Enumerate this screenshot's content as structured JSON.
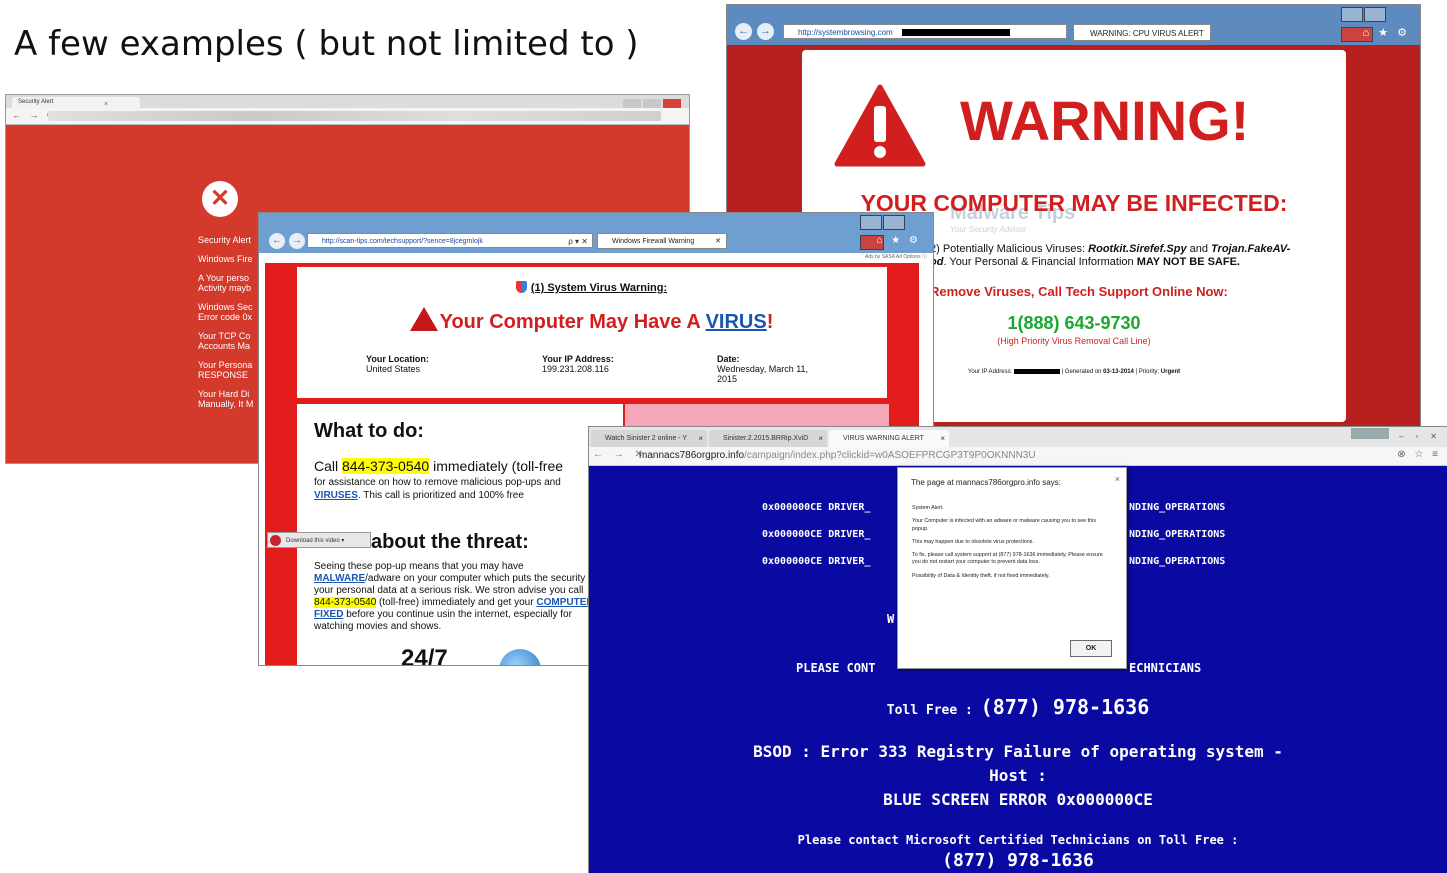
{
  "heading": "A few examples ( but not limited to )",
  "shot1": {
    "tab_title": "Security Alert",
    "tab_close": "×",
    "nav_icons": "← → C",
    "lines": [
      "Security Alert",
      "Windows Fire",
      "A Your perso\nActivity mayb",
      "Windows Sec\nError code 0x",
      "Your TCP Co\nAccounts Ma",
      "Your Persona\nRESPONSE",
      "Your Hard Di\nManually, It M"
    ]
  },
  "shot2": {
    "url": "http://systembrowsing.com",
    "tab_title": "WARNING: CPU VIRUS ALERT",
    "nav_back": "←",
    "nav_fwd": "→",
    "tools": "⌂ ★ ⚙",
    "warning": "WARNING!",
    "infected": "YOUR COMPUTER MAY BE INFECTED:",
    "watermark": "Malware Tips",
    "watermark_sub": "Your Security Advisor",
    "body_1": "2) Potentially Malicious Viruses: ",
    "body_virus": "Rootkit.Sirefef.Spy",
    "body_and": " and ",
    "body_virus2": "Trojan.FakeAV-",
    "body_virus2b": "od",
    "body_2": ". Your Personal & Financial Information ",
    "body_strong": "MAY NOT BE SAFE.",
    "remove": "Remove Viruses, Call Tech Support Online Now:",
    "phone": "1(888) 643-9730",
    "phone_sub": "(High Priority Virus Removal Call Line)",
    "ip_label": "Your IP Address: ",
    "ip_generated": " | Generated on ",
    "ip_date": "03-13-2014",
    "ip_priority": " | Priority: ",
    "ip_priority_val": "Urgent"
  },
  "shot3": {
    "url": "http://scan-tips.com/techsupport/?sence=8jcegmlojk",
    "url_buttons": "ρ ▾ ✕",
    "tab_title": "Windows Firewall Warning",
    "tab_close": "✕",
    "nav_back": "←",
    "nav_fwd": "→",
    "tools": "⌂ ★ ⚙",
    "ads": "Ads by SASA       Ad Options ⓘ",
    "system_warning": "(1) System Virus Warning:",
    "headline_pre": "Your Computer May Have A ",
    "headline_link": "VIRUS",
    "headline_post": "!",
    "location_label": "Your Location:",
    "location_value": "United States",
    "ip_label": "Your IP Address:",
    "ip_value": "199.231.208.116",
    "date_label": "Date:",
    "date_value": "Wednesday, March 11,\n2015",
    "what_to_do": "What to do:",
    "call_pre": "Call ",
    "call_number": "844-373-0540",
    "call_post": " immediately (toll-free",
    "assist_1": "for assistance on how to remove malicious pop-ups and",
    "assist_link": "VIRUSES",
    "assist_2": ". This call is prioritized and 100% free",
    "download_label": "Download this video ▾",
    "about": "about the threat:",
    "seeing_1": "Seeing these pop-up means that you may have",
    "seeing_link1": "MALWARE",
    "seeing_2": "/adware on your computer which puts the security of your personal data at a serious risk. We stron advise you call ",
    "seeing_number": "844-373-0540",
    "seeing_3": " (toll-free) immediately and get your ",
    "seeing_link2": "COMPUTER FIXED",
    "seeing_4": " before you continue usin the internet, especially for watching movies and shows.",
    "twentyfour": "24/7"
  },
  "shot4": {
    "tabs": [
      {
        "label": "Watch Sinister 2 online - Y",
        "close": "×"
      },
      {
        "label": "Sinister.2.2015.BRRip.XviD",
        "close": "×"
      },
      {
        "label": "VIRUS WARNING ALERT",
        "close": "×"
      }
    ],
    "win_buttons": [
      "–",
      "▫",
      "✕"
    ],
    "url_host": "mannacs786orgpro.info",
    "url_path": "/campaign/index.php?clickid=w0ASOEFPRCGP3T9P0OKNNN3U",
    "nav_icons": "← → ✕",
    "right_icons": "⊗ ☆ ≡",
    "driver_left": "0x000000CE DRIVER_",
    "driver_right": "NDING_OPERATIONS",
    "w_fragment": "W",
    "please_left": "PLEASE CONT",
    "please_right": "ECHNICIANS",
    "tollfree_label": "Toll Free : ",
    "tollfree_number": "(877) 978-1636",
    "bsod_1": "BSOD : Error 333 Registry Failure of operating system -",
    "bsod_2": "Host :",
    "bsod_3": "BLUE SCREEN ERROR 0x000000CE",
    "contact": "Please contact Microsoft Certified Technicians on Toll Free :",
    "contact_number": "(877) 978-1636",
    "dialog": {
      "title": "The page at mannacs786orgpro.info says:",
      "close": "×",
      "messages": [
        "System Alert.",
        "Your Computer is infected with an adware or malware causing you to see this popup.",
        "This may happen due to obsolete virus protections.",
        "To fix, please call system support at (877) 978-1636 immediately. Please ensure you do not restart your computer to prevent data loss.",
        "Possibility of Data & Identity theft, if not fixed immediately."
      ],
      "ok": "OK"
    }
  }
}
